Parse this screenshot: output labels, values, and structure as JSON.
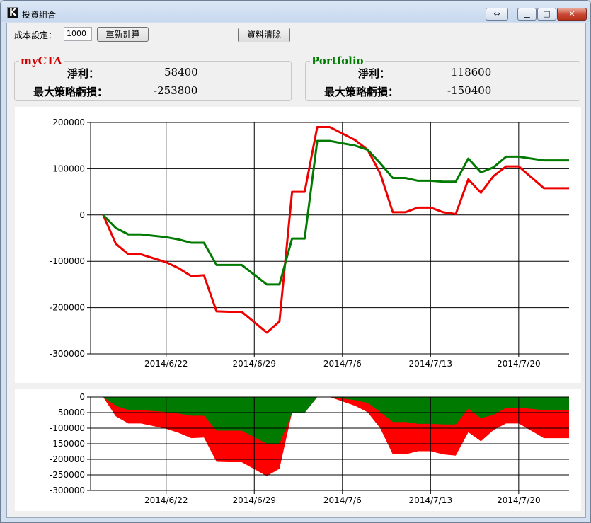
{
  "window": {
    "title": "投資組合",
    "app_icon_letter": "K"
  },
  "titlebar_buttons": {
    "restore_alt": "⇔",
    "minimize": "▁",
    "maximize": "□",
    "close": "✕"
  },
  "toolbar": {
    "cost_label": "成本設定：",
    "cost_value": "1000",
    "recalc_label": "重新計算",
    "clear_label": "資料清除"
  },
  "mycta": {
    "title": "myCTA",
    "title_color": "#d00000",
    "net_profit_label": "淨利：",
    "net_profit_value": "58400",
    "max_dd_label": "最大策略虧損：",
    "max_dd_value": "-253800"
  },
  "portfolio": {
    "title": "Portfolio",
    "title_color": "#007a00",
    "net_profit_label": "淨利：",
    "net_profit_value": "118600",
    "max_dd_label": "最大策略虧損：",
    "max_dd_value": "-150400"
  },
  "chart_data": [
    {
      "type": "line",
      "ylim": [
        -300000,
        200000
      ],
      "yticks": [
        200000,
        100000,
        0,
        -100000,
        -200000,
        -300000
      ],
      "ytick_labels": [
        "200000",
        "100000",
        "0",
        "-100000",
        "-200000",
        "-300000"
      ],
      "xlim": [
        "2014/6/16",
        "2014/7/24"
      ],
      "xticks": [
        "2014/6/22",
        "2014/6/29",
        "2014/7/6",
        "2014/7/13",
        "2014/7/20"
      ],
      "grid": true,
      "series": [
        {
          "name": "myCTA",
          "color": "#ee0000",
          "points": [
            [
              "2014/6/17",
              0
            ],
            [
              "2014/6/18",
              -62000
            ],
            [
              "2014/6/19",
              -85000
            ],
            [
              "2014/6/20",
              -85000
            ],
            [
              "2014/6/22",
              -102000
            ],
            [
              "2014/6/23",
              -115000
            ],
            [
              "2014/6/24",
              -132000
            ],
            [
              "2014/6/25",
              -130000
            ],
            [
              "2014/6/26",
              -208000
            ],
            [
              "2014/6/27",
              -209000
            ],
            [
              "2014/6/28",
              -209000
            ],
            [
              "2014/6/30",
              -254000
            ],
            [
              "2014/7/1",
              -230000
            ],
            [
              "2014/7/2",
              50000
            ],
            [
              "2014/7/3",
              50000
            ],
            [
              "2014/7/4",
              190000
            ],
            [
              "2014/7/5",
              190000
            ],
            [
              "2014/7/7",
              162000
            ],
            [
              "2014/7/8",
              141000
            ],
            [
              "2014/7/9",
              90000
            ],
            [
              "2014/7/10",
              6000
            ],
            [
              "2014/7/11",
              6000
            ],
            [
              "2014/7/12",
              16000
            ],
            [
              "2014/7/13",
              16000
            ],
            [
              "2014/7/14",
              6000
            ],
            [
              "2014/7/15",
              2000
            ],
            [
              "2014/7/16",
              77000
            ],
            [
              "2014/7/17",
              48000
            ],
            [
              "2014/7/18",
              84000
            ],
            [
              "2014/7/19",
              105000
            ],
            [
              "2014/7/20",
              105000
            ],
            [
              "2014/7/22",
              58000
            ],
            [
              "2014/7/23",
              58000
            ],
            [
              "2014/7/24",
              58000
            ]
          ]
        },
        {
          "name": "Portfolio",
          "color": "#007a00",
          "points": [
            [
              "2014/6/17",
              0
            ],
            [
              "2014/6/18",
              -28000
            ],
            [
              "2014/6/19",
              -42000
            ],
            [
              "2014/6/20",
              -42000
            ],
            [
              "2014/6/22",
              -48000
            ],
            [
              "2014/6/23",
              -53000
            ],
            [
              "2014/6/24",
              -60000
            ],
            [
              "2014/6/25",
              -60000
            ],
            [
              "2014/6/26",
              -108000
            ],
            [
              "2014/6/27",
              -108000
            ],
            [
              "2014/6/28",
              -108000
            ],
            [
              "2014/6/30",
              -150000
            ],
            [
              "2014/7/1",
              -150000
            ],
            [
              "2014/7/2",
              -51000
            ],
            [
              "2014/7/3",
              -51000
            ],
            [
              "2014/7/4",
              160000
            ],
            [
              "2014/7/5",
              160000
            ],
            [
              "2014/7/7",
              150000
            ],
            [
              "2014/7/8",
              141000
            ],
            [
              "2014/7/9",
              112000
            ],
            [
              "2014/7/10",
              80000
            ],
            [
              "2014/7/11",
              80000
            ],
            [
              "2014/7/12",
              74000
            ],
            [
              "2014/7/13",
              74000
            ],
            [
              "2014/7/14",
              72000
            ],
            [
              "2014/7/15",
              72000
            ],
            [
              "2014/7/16",
              122000
            ],
            [
              "2014/7/17",
              92000
            ],
            [
              "2014/7/18",
              103000
            ],
            [
              "2014/7/19",
              126000
            ],
            [
              "2014/7/20",
              126000
            ],
            [
              "2014/7/22",
              118000
            ],
            [
              "2014/7/23",
              118000
            ],
            [
              "2014/7/24",
              118000
            ]
          ]
        }
      ]
    },
    {
      "type": "area",
      "ylim": [
        -300000,
        0
      ],
      "yticks": [
        0,
        -50000,
        -100000,
        -150000,
        -200000,
        -250000,
        -300000
      ],
      "ytick_labels": [
        "0",
        "-50000",
        "-100000",
        "-150000",
        "-200000",
        "-250000",
        "-300000"
      ],
      "xlim": [
        "2014/6/16",
        "2014/7/24"
      ],
      "xticks": [
        "2014/6/22",
        "2014/6/29",
        "2014/7/6",
        "2014/7/13",
        "2014/7/20"
      ],
      "grid": true,
      "series": [
        {
          "name": "myCTA",
          "color": "#ff0000",
          "points": [
            [
              "2014/6/17",
              0
            ],
            [
              "2014/6/18",
              -62000
            ],
            [
              "2014/6/19",
              -85000
            ],
            [
              "2014/6/20",
              -85000
            ],
            [
              "2014/6/22",
              -102000
            ],
            [
              "2014/6/23",
              -115000
            ],
            [
              "2014/6/24",
              -132000
            ],
            [
              "2014/6/25",
              -130000
            ],
            [
              "2014/6/26",
              -208000
            ],
            [
              "2014/6/27",
              -209000
            ],
            [
              "2014/6/28",
              -209000
            ],
            [
              "2014/6/30",
              -254000
            ],
            [
              "2014/7/1",
              -230000
            ],
            [
              "2014/7/2",
              -50000
            ],
            [
              "2014/7/3",
              -50000
            ],
            [
              "2014/7/4",
              0
            ],
            [
              "2014/7/5",
              0
            ],
            [
              "2014/7/7",
              -28000
            ],
            [
              "2014/7/8",
              -49000
            ],
            [
              "2014/7/9",
              -100000
            ],
            [
              "2014/7/10",
              -184000
            ],
            [
              "2014/7/11",
              -184000
            ],
            [
              "2014/7/12",
              -174000
            ],
            [
              "2014/7/13",
              -174000
            ],
            [
              "2014/7/14",
              -184000
            ],
            [
              "2014/7/15",
              -188000
            ],
            [
              "2014/7/16",
              -113000
            ],
            [
              "2014/7/17",
              -142000
            ],
            [
              "2014/7/18",
              -106000
            ],
            [
              "2014/7/19",
              -85000
            ],
            [
              "2014/7/20",
              -85000
            ],
            [
              "2014/7/22",
              -132000
            ],
            [
              "2014/7/23",
              -132000
            ],
            [
              "2014/7/24",
              -132000
            ]
          ]
        },
        {
          "name": "Portfolio",
          "color": "#007a00",
          "points": [
            [
              "2014/6/17",
              0
            ],
            [
              "2014/6/18",
              -28000
            ],
            [
              "2014/6/19",
              -42000
            ],
            [
              "2014/6/20",
              -42000
            ],
            [
              "2014/6/22",
              -48000
            ],
            [
              "2014/6/23",
              -53000
            ],
            [
              "2014/6/24",
              -60000
            ],
            [
              "2014/6/25",
              -60000
            ],
            [
              "2014/6/26",
              -108000
            ],
            [
              "2014/6/27",
              -108000
            ],
            [
              "2014/6/28",
              -108000
            ],
            [
              "2014/6/30",
              -150000
            ],
            [
              "2014/7/1",
              -150000
            ],
            [
              "2014/7/2",
              -51000
            ],
            [
              "2014/7/3",
              -51000
            ],
            [
              "2014/7/4",
              0
            ],
            [
              "2014/7/5",
              0
            ],
            [
              "2014/7/7",
              -10000
            ],
            [
              "2014/7/8",
              -19000
            ],
            [
              "2014/7/9",
              -48000
            ],
            [
              "2014/7/10",
              -80000
            ],
            [
              "2014/7/11",
              -80000
            ],
            [
              "2014/7/12",
              -86000
            ],
            [
              "2014/7/13",
              -86000
            ],
            [
              "2014/7/14",
              -88000
            ],
            [
              "2014/7/15",
              -88000
            ],
            [
              "2014/7/16",
              -38000
            ],
            [
              "2014/7/17",
              -68000
            ],
            [
              "2014/7/18",
              -57000
            ],
            [
              "2014/7/19",
              -34000
            ],
            [
              "2014/7/20",
              -34000
            ],
            [
              "2014/7/22",
              -42000
            ],
            [
              "2014/7/23",
              -42000
            ],
            [
              "2014/7/24",
              -42000
            ]
          ]
        }
      ]
    }
  ]
}
